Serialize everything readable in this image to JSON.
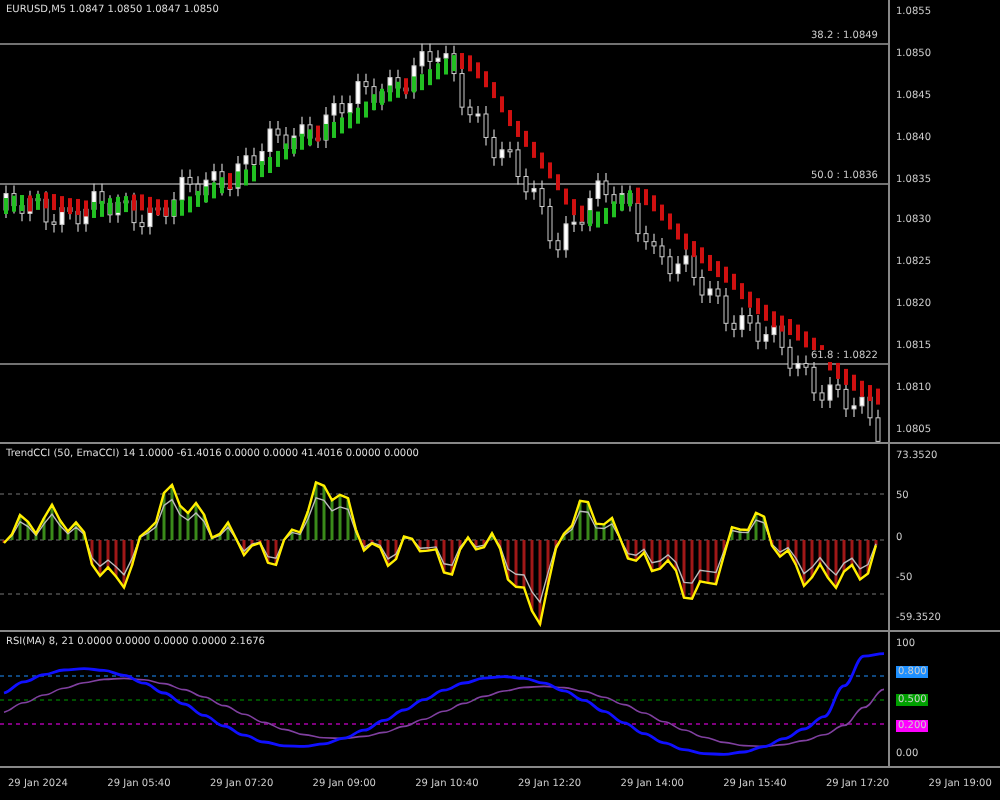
{
  "main_pane": {
    "header": "EURUSD,M5 1.0847 1.0850 1.0847 1.0850",
    "axis_labels": [
      "1.0855",
      "1.0850",
      "1.0845",
      "1.0840",
      "1.0835",
      "1.0830",
      "1.0825",
      "1.0820",
      "1.0815",
      "1.0810",
      "1.0805"
    ],
    "fib_levels": [
      {
        "label": "38.2 : 1.0849"
      },
      {
        "label": "50.0 : 1.0836"
      },
      {
        "label": "61.8 : 1.0822"
      }
    ]
  },
  "oscillator_pane": {
    "header": "TrendCCI (50, EmaCCI) 14 1.0000 -61.4016 0.0000 0.0000 41.4016 0.0000 0.0000",
    "axis_labels": [
      "73.3520",
      "50",
      "0",
      "-50",
      "-59.3520"
    ]
  },
  "stochastic_pane": {
    "header": "RSI(MA) 8, 21 0.0000 0.0000 0.0000 0.0000 2.1676",
    "axis_labels": [
      "100",
      "0.00"
    ],
    "level_badges": [
      {
        "label": "0.800",
        "color": "#1e90ff"
      },
      {
        "label": "0.500",
        "color": "#00a000"
      },
      {
        "label": "0.200",
        "color": "#ff00ff"
      }
    ]
  },
  "time_labels": [
    "29 Jan 2024",
    "29 Jan 05:40",
    "29 Jan 07:20",
    "29 Jan 09:00",
    "29 Jan 10:40",
    "29 Jan 12:20",
    "29 Jan 14:00",
    "29 Jan 15:40",
    "29 Jan 17:20",
    "29 Jan 19:00"
  ]
}
